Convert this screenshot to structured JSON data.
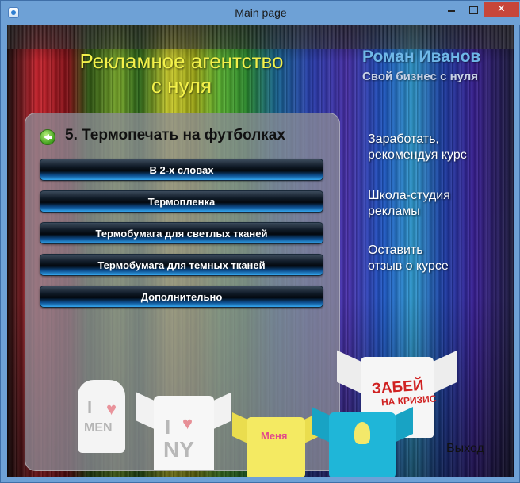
{
  "window": {
    "title": "Main page",
    "minimize_label": "",
    "maximize_label": "",
    "close_label": "✕"
  },
  "header": {
    "agency_title_line1": "Рекламное агентство",
    "agency_title_line2": "с нуля",
    "author_name": "Роман Иванов",
    "author_tagline": "Свой бизнес с нуля"
  },
  "panel": {
    "section_title": "5. Термопечать на футболках",
    "buttons": [
      {
        "label": "В 2-х словах"
      },
      {
        "label": "Термопленка"
      },
      {
        "label": "Термобумага для светлых тканей"
      },
      {
        "label": "Термобумага для темных тканей"
      },
      {
        "label": "Дополнительно"
      }
    ]
  },
  "sidebar": {
    "links": [
      {
        "line1": "Заработать,",
        "line2": "рекомендуя курс"
      },
      {
        "line1": "Школа-студия",
        "line2": "рекламы"
      },
      {
        "line1": "Оставить",
        "line2": "отзыв о курсе"
      }
    ],
    "exit_label": "Выход"
  },
  "shirts": {
    "tank_line1": "I",
    "tank_line2": "MEN",
    "ny_line1": "I",
    "ny_line2": "NY",
    "yellow_text": "Меня",
    "red_line1": "ЗАБЕЙ",
    "red_line2": "НА КРИЗИС"
  },
  "colors": {
    "agency_title": "#f2f04a",
    "author_name": "#6fb8e8",
    "titlebar": "#6ea1d6",
    "close_button": "#c7463a"
  }
}
